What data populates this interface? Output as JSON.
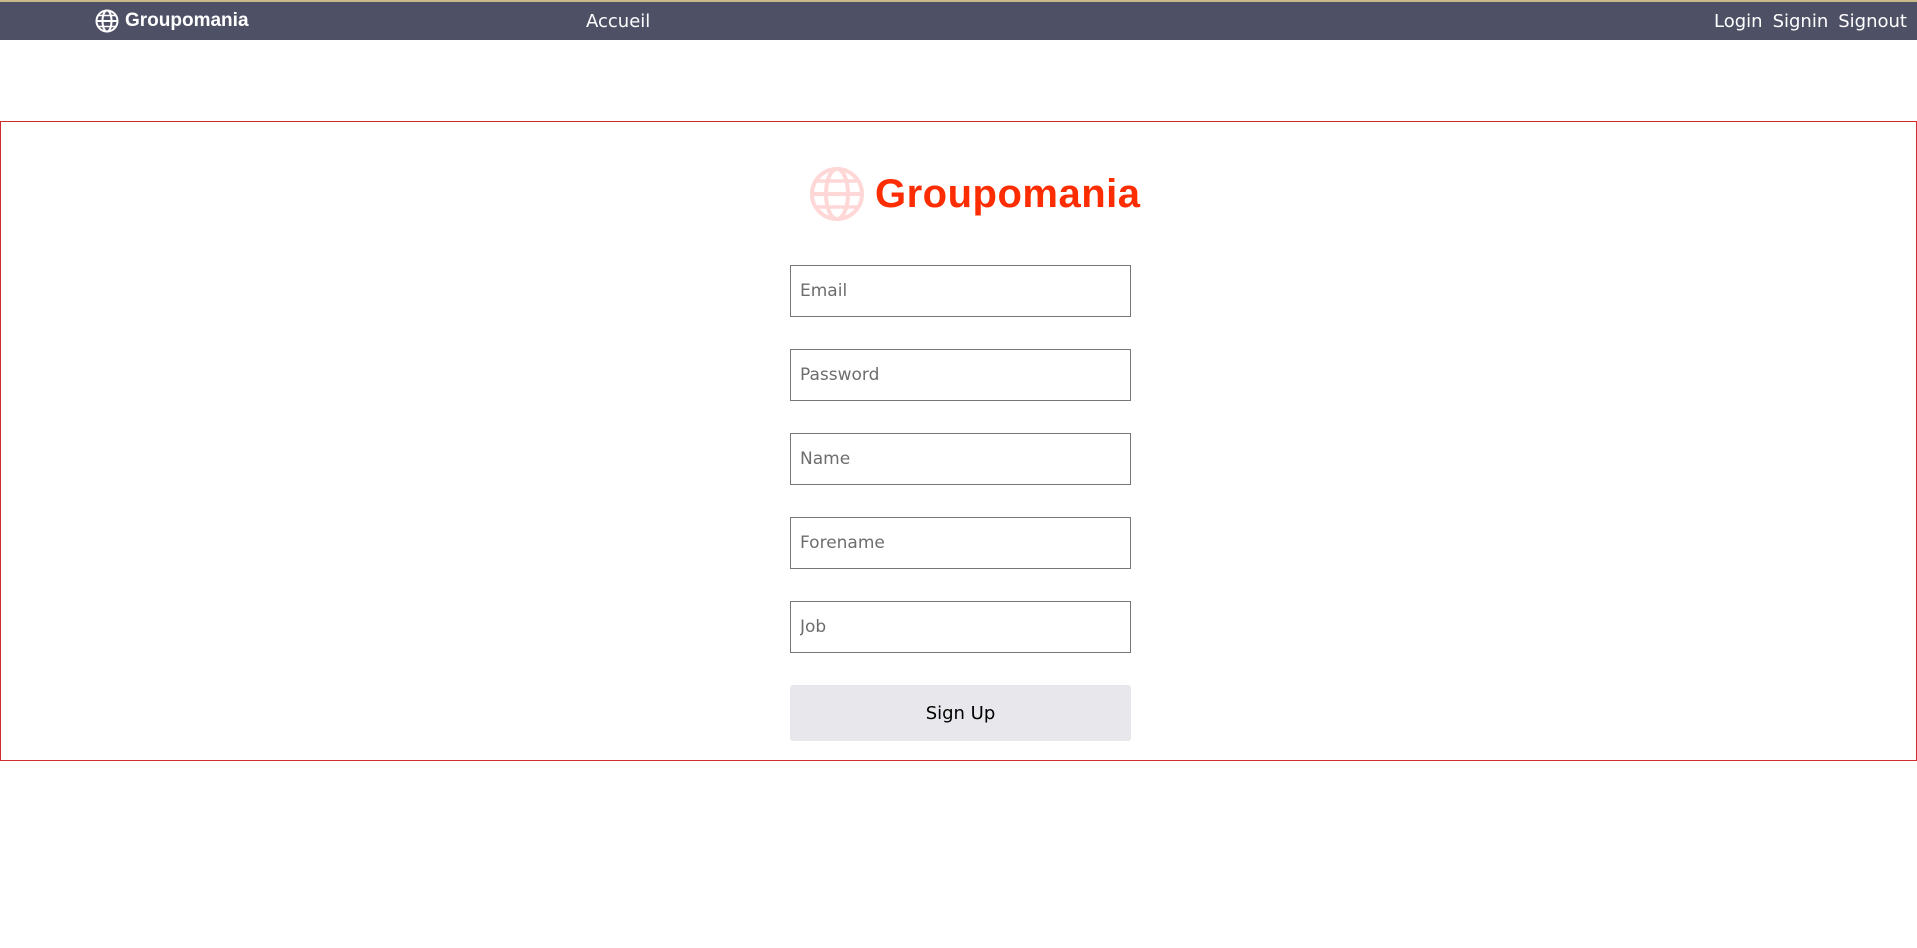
{
  "nav": {
    "brand": "Groupomania",
    "home": "Accueil",
    "links": [
      "Login",
      "Signin",
      "Signout"
    ]
  },
  "logo": {
    "text": "Groupomania",
    "icon": "globe-icon",
    "color": "#fd2d01",
    "icon_color": "#ffd7d7"
  },
  "form": {
    "email_placeholder": "Email",
    "password_placeholder": "Password",
    "name_placeholder": "Name",
    "forename_placeholder": "Forename",
    "job_placeholder": "Job",
    "submit_label": "Sign Up"
  },
  "colors": {
    "navbar": "#4e5166",
    "section_border": "#d22b2b"
  }
}
